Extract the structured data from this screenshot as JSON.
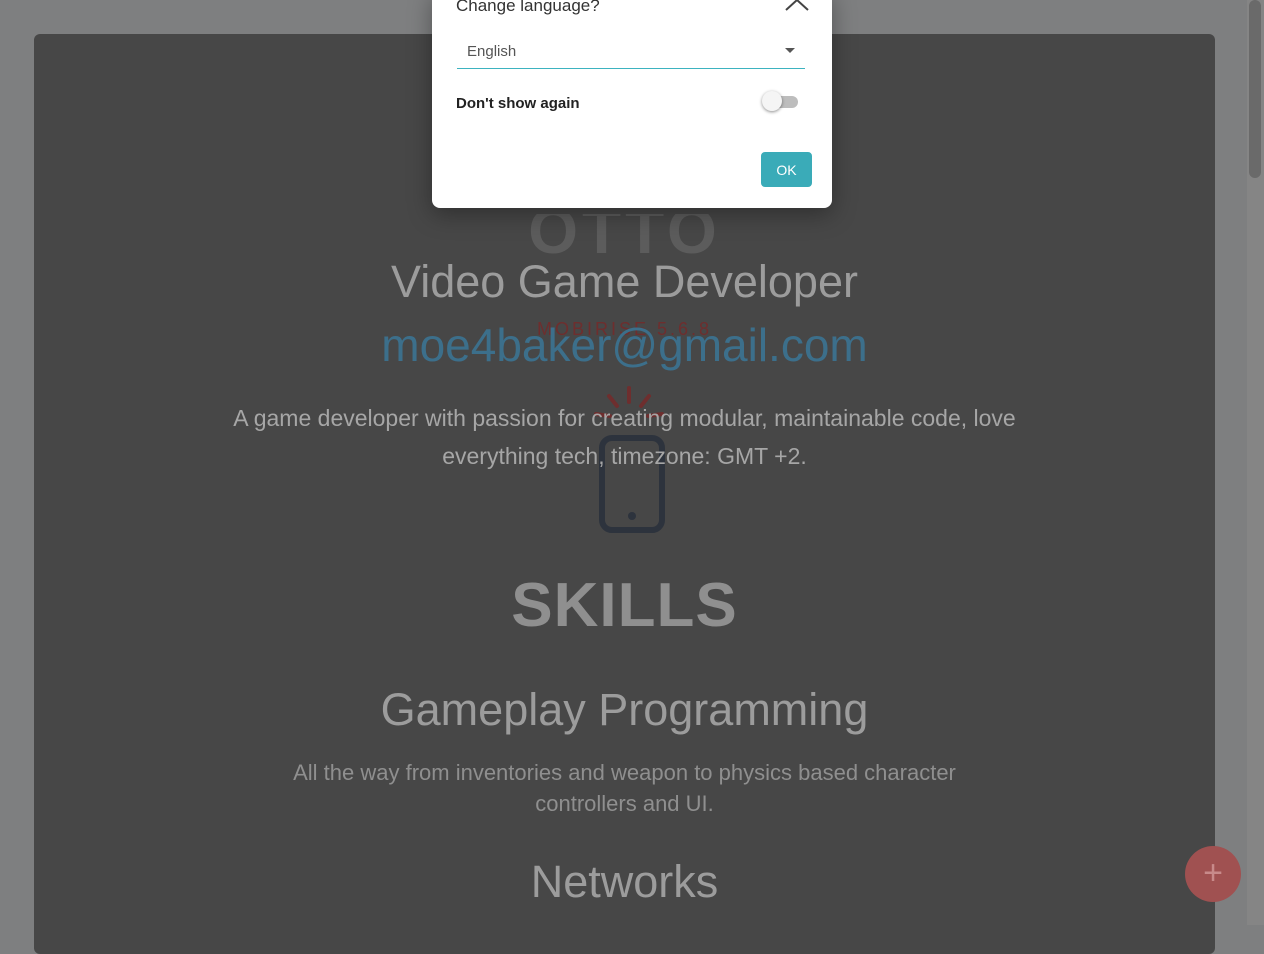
{
  "dialog": {
    "title": "Change language?",
    "language_value": "English",
    "dont_show_label": "Don't show again",
    "dont_show_checked": false,
    "ok_label": "OK"
  },
  "profile": {
    "heading_partial": "OTTO",
    "role": "Video Game Developer",
    "overlay_text": "MOBIRISE 5.6.8",
    "email": "moe4baker@gmail.com",
    "description": "A game developer with passion for creating modular, maintainable code, love everything tech, timezone: GMT +2."
  },
  "skills": {
    "heading": "SKILLS",
    "items": [
      {
        "title": "Gameplay Programming",
        "desc": "All the way from inventories and weapon to physics based character controllers and UI."
      },
      {
        "title": "Networks",
        "desc": ""
      }
    ]
  },
  "fab": {
    "label": "+"
  },
  "colors": {
    "accent": "#3aabb8",
    "fab": "#a05151",
    "email": "#3c6f8b"
  }
}
